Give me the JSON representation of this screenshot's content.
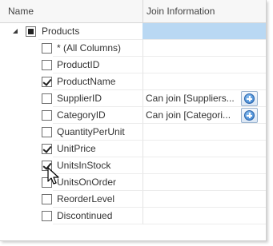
{
  "header": {
    "col_name": "Name",
    "col_join": "Join Information"
  },
  "tree": {
    "root": {
      "label": "Products",
      "expanded": true,
      "check_state": "indeterminate"
    },
    "columns": [
      {
        "label": "* (All Columns)",
        "checked": false,
        "join": ""
      },
      {
        "label": "ProductID",
        "checked": false,
        "join": ""
      },
      {
        "label": "ProductName",
        "checked": true,
        "join": ""
      },
      {
        "label": "SupplierID",
        "checked": false,
        "join": "Can join [Suppliers..."
      },
      {
        "label": "CategoryID",
        "checked": false,
        "join": "Can join [Categori..."
      },
      {
        "label": "QuantityPerUnit",
        "checked": false,
        "join": ""
      },
      {
        "label": "UnitPrice",
        "checked": true,
        "join": ""
      },
      {
        "label": "UnitsInStock",
        "checked": true,
        "join": ""
      },
      {
        "label": "UnitsOnOrder",
        "checked": false,
        "join": ""
      },
      {
        "label": "ReorderLevel",
        "checked": false,
        "join": ""
      },
      {
        "label": "Discontinued",
        "checked": false,
        "join": ""
      }
    ]
  },
  "icons": {
    "expander": "expanded-triangle-icon",
    "join_add": "add-join-plus-icon",
    "cursor": "mouse-pointer-icon"
  },
  "colors": {
    "selection": "#b9d8f3",
    "header_bg": "#f7f7f7",
    "button_border": "#9ab3cf"
  }
}
